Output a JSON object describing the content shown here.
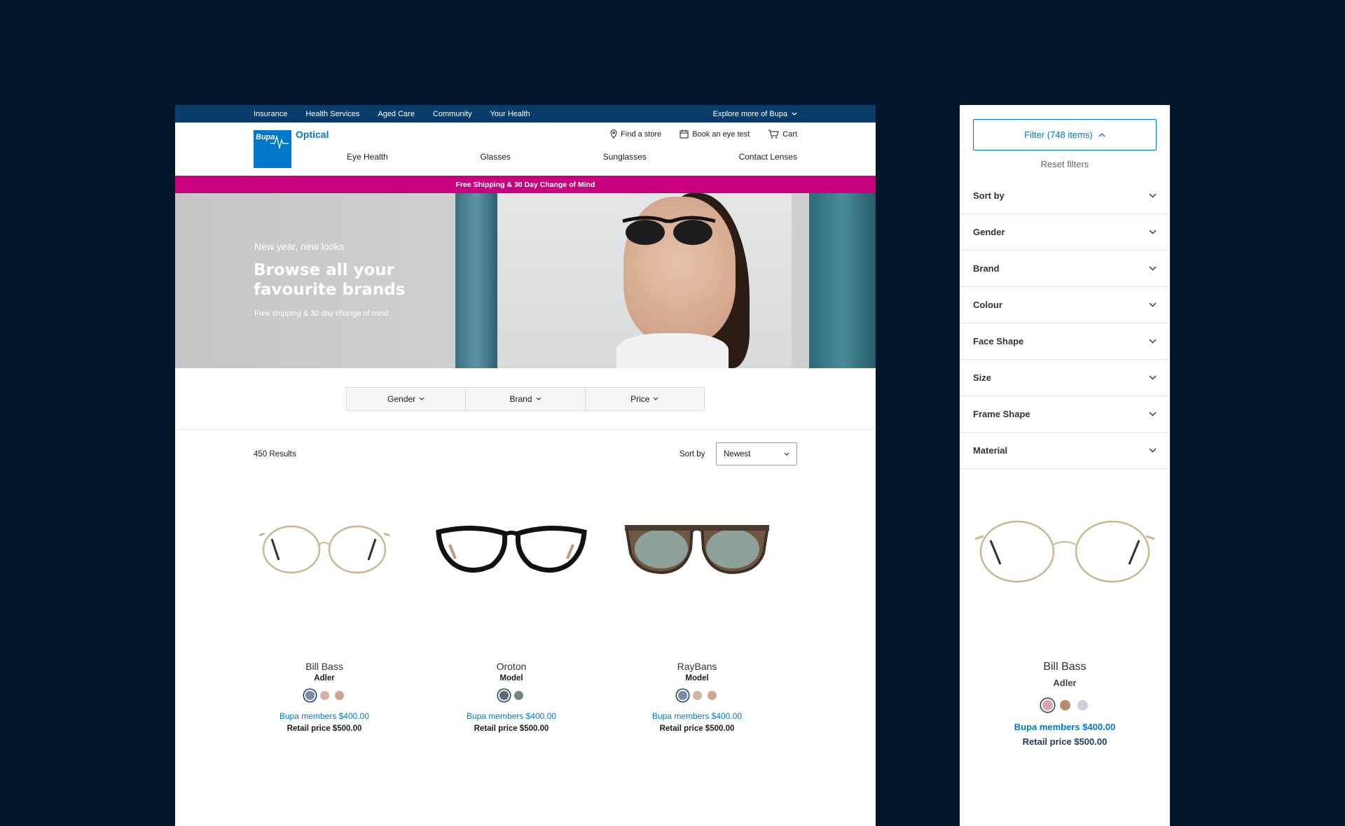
{
  "topbar": {
    "links": [
      "Insurance",
      "Health Services",
      "Aged Care",
      "Community",
      "Your Health"
    ],
    "explore": "Explore more of Bupa"
  },
  "header": {
    "logo_text": "Bupa",
    "brand_suffix": "Optical",
    "utilities": {
      "find_store": "Find a store",
      "book_test": "Book an eye test",
      "cart": "Cart"
    },
    "nav": [
      "Eye Health",
      "Glasses",
      "Sunglasses",
      "Contact Lenses"
    ]
  },
  "promo": "Free Shipping & 30 Day Change of Mind",
  "hero": {
    "kicker": "New year, new looks",
    "title": "Browse all your favourite brands",
    "subtitle": "Free shipping & 30 day change of mind"
  },
  "filters": [
    "Gender",
    "Brand",
    "Price"
  ],
  "listing": {
    "results": "450 Results",
    "sort_label": "Sort by",
    "sort_value": "Newest"
  },
  "products": [
    {
      "brand": "Bill Bass",
      "model": "Adler",
      "member_price": "Bupa members $400.00",
      "retail_price": "Retail price $500.00",
      "swatches": [
        "#7d8aa3",
        "#d4b3a3",
        "#cfa58f"
      ]
    },
    {
      "brand": "Oroton",
      "model": "Model",
      "member_price": "Bupa members $400.00",
      "retail_price": "Retail price $500.00",
      "swatches": [
        "#5f6b73",
        "#6f8a77"
      ]
    },
    {
      "brand": "RayBans",
      "model": "Model",
      "member_price": "Bupa members $400.00",
      "retail_price": "Retail price $500.00",
      "swatches": [
        "#7d8aa3",
        "#d4b3a3",
        "#cfa58f"
      ]
    }
  ],
  "mobile": {
    "filter_button": "Filter (748 items)",
    "reset": "Reset filters",
    "accordion": [
      "Sort by",
      "Gender",
      "Brand",
      "Colour",
      "Face Shape",
      "Size",
      "Frame Shape",
      "Material"
    ],
    "product": {
      "brand": "Bill Bass",
      "model": "Adler",
      "member_price": "Bupa members $400.00",
      "retail_price": "Retail price $500.00",
      "swatches": [
        "#d2a8a8",
        "#b68d72",
        "#cfcfe0"
      ]
    }
  },
  "colors": {
    "primary": "#0079c8",
    "navy": "#0a3c6b",
    "promo": "#c9007d",
    "background": "#02152a"
  }
}
